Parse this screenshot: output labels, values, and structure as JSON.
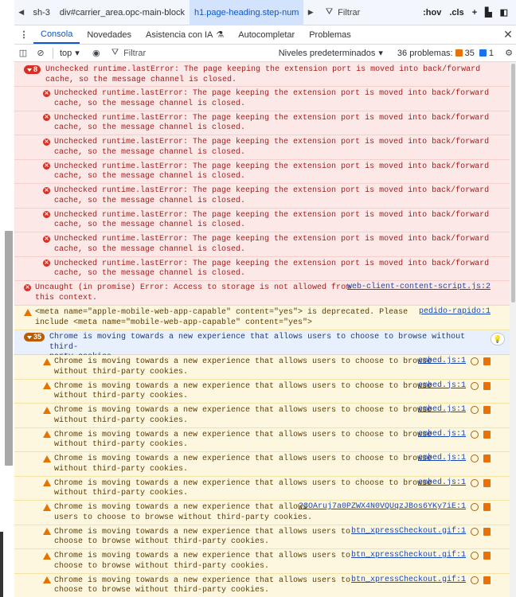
{
  "crumbbar": {
    "items": [
      "sh-3",
      "div#carrier_area.opc-main-block",
      "h1.page-heading.step-num"
    ],
    "selected_index": 2,
    "filter_placeholder": "Filtrar",
    "tool_hov": ":hov",
    "tool_cls": ".cls"
  },
  "tabs": {
    "items": [
      "Consola",
      "Novedades",
      "Asistencia con IA",
      "Autocompletar",
      "Problemas"
    ],
    "active_index": 0
  },
  "toolbar": {
    "context": "top",
    "filter_placeholder": "Filtrar",
    "levels": "Niveles predeterminados",
    "problems_label": "36 problemas:",
    "problems_warn": "35",
    "problems_info": "1"
  },
  "console": {
    "group_error_count": "8",
    "group_error_text": "Unchecked runtime.lastError: The page keeping the extension port is moved into back/forward\ncache, so the message channel is closed.",
    "child_error_text": "Unchecked runtime.lastError: The page keeping the extension port is moved into back/forward\ncache, so the message channel is closed.",
    "uncaught_text": "Uncaught (in promise) Error: Access to storage is not allowed from\nthis context.",
    "uncaught_src": "web-client-content-script.js:2",
    "meta_text": "<meta name=\"apple-mobile-web-app-capable\" content=\"yes\"> is deprecated. Please\ninclude <meta name=\"mobile-web-app-capable\" content=\"yes\">",
    "meta_src": "pedido-rapido:1",
    "group_warn_count": "35",
    "group_warn_text": "Chrome is moving towards a new experience that allows users to choose to browse without third-\nparty cookies.",
    "warn_rows": [
      {
        "text": "Chrome is moving towards a new experience that allows users to choose to browse\nwithout third-party cookies.",
        "src": "embed.js:1"
      },
      {
        "text": "Chrome is moving towards a new experience that allows users to choose to browse\nwithout third-party cookies.",
        "src": "embed.js:1"
      },
      {
        "text": "Chrome is moving towards a new experience that allows users to choose to browse\nwithout third-party cookies.",
        "src": "embed.js:1"
      },
      {
        "text": "Chrome is moving towards a new experience that allows users to choose to browse\nwithout third-party cookies.",
        "src": "embed.js:1"
      },
      {
        "text": "Chrome is moving towards a new experience that allows users to choose to browse\nwithout third-party cookies.",
        "src": "embed.js:1"
      },
      {
        "text": "Chrome is moving towards a new experience that allows users to choose to browse\nwithout third-party cookies.",
        "src": "embed.js:1"
      },
      {
        "text": "Chrome is moving towards a new experience that allows\nusers to choose to browse without third-party cookies.",
        "src": "?3OAruj7a0PZWX4N0VQUqzJBos6YKy7iE:1"
      },
      {
        "text": "Chrome is moving towards a new experience that allows users to\nchoose to browse without third-party cookies.",
        "src": "btn_xpressCheckout.gif:1"
      },
      {
        "text": "Chrome is moving towards a new experience that allows users to\nchoose to browse without third-party cookies.",
        "src": "btn_xpressCheckout.gif:1"
      },
      {
        "text": "Chrome is moving towards a new experience that allows users to\nchoose to browse without third-party cookies.",
        "src": "btn_xpressCheckout.gif:1"
      }
    ]
  },
  "colors": {
    "error_bg": "#fce8e6",
    "warn_bg": "#fef7e0",
    "info_bg": "#e8f0fe",
    "accent": "#0b57d0"
  }
}
